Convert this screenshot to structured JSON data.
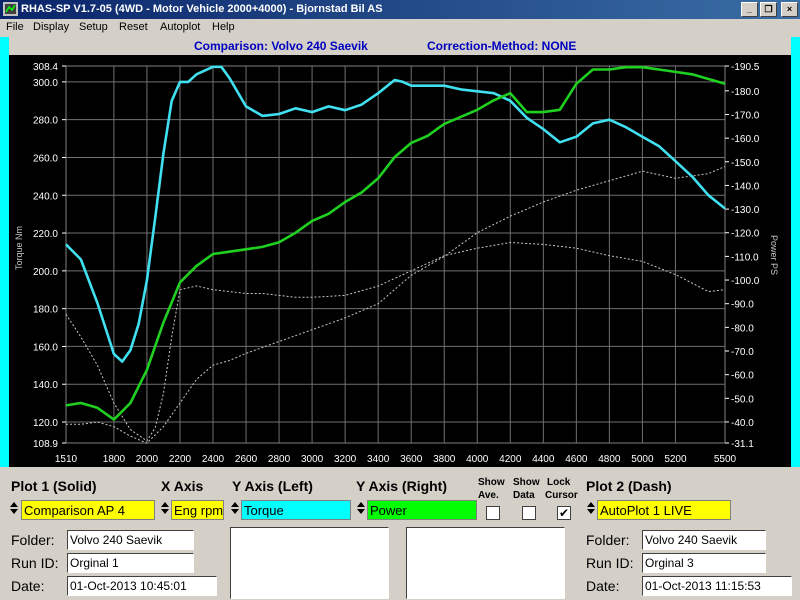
{
  "window": {
    "title": "RHAS-SP V1.7-05  (4WD - Motor Vehicle 2000+4000) - Bjornstad Bil AS",
    "buttons": {
      "minimize": "_",
      "restore": "❐",
      "close": "×"
    }
  },
  "menu": [
    "File",
    "Display",
    "Setup",
    "Reset",
    "Autoplot",
    "Help"
  ],
  "header": {
    "comparison": "Comparison: Volvo 240 Saevik",
    "correction": "Correction-Method: NONE"
  },
  "chart_data": {
    "type": "line",
    "xlabel": "",
    "ylabel": "Torque Nm",
    "y2label": "Power PS",
    "xlim": [
      1510,
      5500
    ],
    "ylim": [
      108.9,
      308.4
    ],
    "y2lim": [
      31.1,
      190.5
    ],
    "grid": true,
    "x_ticks": [
      "1510",
      "1800",
      "2000",
      "2200",
      "2400",
      "2600",
      "2800",
      "3000",
      "3200",
      "3400",
      "3600",
      "3800",
      "4000",
      "4200",
      "4400",
      "4600",
      "4800",
      "5000",
      "5200",
      "5500"
    ],
    "y_ticks": [
      "308.4",
      "300.0",
      "280.0",
      "260.0",
      "240.0",
      "220.0",
      "200.0",
      "180.0",
      "160.0",
      "140.0",
      "120.0",
      "108.9"
    ],
    "y2_ticks": [
      "190.5",
      "180.0",
      "170.0",
      "160.0",
      "150.0",
      "140.0",
      "130.0",
      "120.0",
      "110.0",
      "100.0",
      "90.0",
      "80.0",
      "70.0",
      "60.0",
      "50.0",
      "40.0",
      "31.1"
    ],
    "series": [
      {
        "name": "Torque",
        "axis": "left",
        "style": "solid",
        "color": "#40e0f0",
        "x": [
          1510,
          1600,
          1700,
          1800,
          1850,
          1900,
          1950,
          2000,
          2050,
          2100,
          2150,
          2200,
          2250,
          2300,
          2400,
          2450,
          2500,
          2600,
          2700,
          2800,
          2900,
          3000,
          3100,
          3200,
          3300,
          3400,
          3500,
          3550,
          3600,
          3700,
          3800,
          3900,
          4000,
          4100,
          4200,
          4300,
          4400,
          4500,
          4600,
          4700,
          4800,
          4900,
          5000,
          5100,
          5200,
          5300,
          5400,
          5500
        ],
        "y": [
          214,
          206,
          183,
          156,
          152,
          158,
          172,
          195,
          228,
          262,
          290,
          300,
          300,
          304,
          308,
          308,
          302,
          287,
          282,
          283,
          286,
          284,
          287,
          285,
          288,
          294,
          301,
          300,
          298,
          298,
          298,
          296,
          295,
          294,
          290,
          281,
          275,
          268,
          271,
          278,
          280,
          276,
          271,
          266,
          258,
          250,
          240,
          233
        ]
      },
      {
        "name": "Power",
        "axis": "right",
        "style": "solid",
        "color": "#20d020",
        "x": [
          1510,
          1600,
          1700,
          1800,
          1900,
          2000,
          2100,
          2200,
          2300,
          2400,
          2500,
          2600,
          2700,
          2800,
          2900,
          3000,
          3100,
          3200,
          3300,
          3400,
          3500,
          3600,
          3700,
          3800,
          3900,
          4000,
          4100,
          4200,
          4300,
          4400,
          4500,
          4600,
          4700,
          4800,
          4900,
          5000,
          5100,
          5200,
          5300,
          5400,
          5500
        ],
        "y": [
          47,
          48,
          46,
          41,
          48,
          62,
          82,
          99,
          106,
          111,
          112,
          113,
          114,
          116,
          120,
          125,
          128,
          133,
          137,
          143,
          152,
          158,
          161,
          166,
          169,
          172,
          176,
          179,
          171,
          171,
          172,
          183,
          189,
          189,
          190,
          190,
          189,
          188,
          187,
          185,
          183
        ]
      },
      {
        "name": "Torque (Plot 2)",
        "axis": "left",
        "style": "dash",
        "color": "#c8c8c8",
        "x": [
          1510,
          1600,
          1700,
          1800,
          1900,
          2000,
          2050,
          2100,
          2150,
          2200,
          2300,
          2400,
          2500,
          2600,
          2700,
          2800,
          2900,
          3000,
          3200,
          3400,
          3600,
          3800,
          4000,
          4200,
          4400,
          4600,
          4800,
          5000,
          5200,
          5400,
          5500
        ],
        "y": [
          177,
          165,
          150,
          130,
          116,
          110,
          117,
          135,
          165,
          190,
          192,
          190,
          189,
          188,
          188,
          187,
          186,
          186,
          187,
          192,
          200,
          208,
          212,
          215,
          214,
          212,
          208,
          205,
          198,
          189,
          190
        ]
      },
      {
        "name": "Power (Plot 2)",
        "axis": "right",
        "style": "dash",
        "color": "#c8c8c8",
        "x": [
          1510,
          1600,
          1700,
          1800,
          1900,
          2000,
          2100,
          2200,
          2300,
          2400,
          2500,
          2600,
          2800,
          3000,
          3200,
          3400,
          3600,
          3800,
          4000,
          4200,
          4400,
          4600,
          4800,
          5000,
          5200,
          5400,
          5500
        ],
        "y": [
          39,
          39,
          40,
          38,
          34,
          31,
          38,
          48,
          58,
          64,
          66,
          69,
          74,
          79,
          84,
          90,
          102,
          110,
          120,
          127,
          133,
          138,
          142,
          146,
          143,
          145,
          148
        ]
      }
    ]
  },
  "panel": {
    "plot1_title": "Plot 1 (Solid)",
    "x_axis_title": "X Axis",
    "y_left_title": "Y Axis (Left)",
    "y_right_title": "Y Axis (Right)",
    "show_ave": "Show",
    "show_ave2": "Ave.",
    "show_data": "Show",
    "show_data2": "Data",
    "lock_cursor": "Lock",
    "lock_cursor2": "Cursor",
    "plot2_title": "Plot 2 (Dash)",
    "plot1_select": "Comparison AP 4",
    "x_axis_select": "Eng rpm",
    "y_left_select": "Torque",
    "y_right_select": "Power",
    "plot2_select": "AutoPlot 1 LIVE",
    "lock_cursor_checked": "✔",
    "labels": {
      "folder": "Folder:",
      "runid": "Run ID:",
      "date": "Date:"
    },
    "plot1": {
      "folder": "Volvo 240 Saevik",
      "runid": "Orginal      1",
      "date": "01-Oct-2013  10:45:01"
    },
    "plot2": {
      "folder": "Volvo 240 Saevik",
      "runid": "Orginal      3",
      "date": "01-Oct-2013  11:15:53"
    },
    "colors": {
      "yellow": "#ffff00",
      "cyan": "#00ffff",
      "green": "#00ff00"
    }
  }
}
